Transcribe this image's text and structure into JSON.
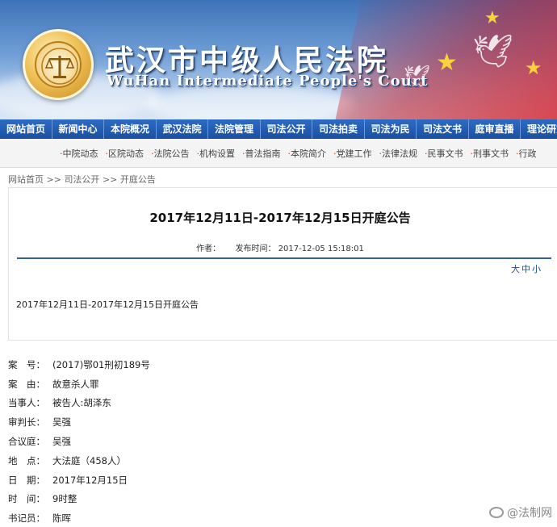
{
  "header": {
    "court_name_cn": "武汉市中级人民法院",
    "court_name_en": "WuHan Intermediate People's Court",
    "emblem_icon": "court-emblem-icon"
  },
  "main_nav": [
    "网站首页",
    "新闻中心",
    "本院概况",
    "武汉法院",
    "法院管理",
    "司法公开",
    "司法拍卖",
    "司法为民",
    "司法文书",
    "庭审直播",
    "理论研究"
  ],
  "sub_nav": [
    "中院动态",
    "区院动态",
    "法院公告",
    "机构设置",
    "普法指南",
    "本院简介",
    "党建工作",
    "法律法规",
    "民事文书",
    "刑事文书",
    "行政"
  ],
  "breadcrumb": {
    "home": "网站首页",
    "sep": ">>",
    "section": "司法公开",
    "current": "开庭公告"
  },
  "article": {
    "title": "2017年12月11日-2017年12月15日开庭公告",
    "author_label": "作者：",
    "publish_label": "发布时间：",
    "publish_time": "2017-12-05 15:18:01",
    "font_size_options": [
      "大",
      "中",
      "小"
    ],
    "lead": "2017年12月11日-2017年12月15日开庭公告"
  },
  "case_details": [
    {
      "label": "案　号：",
      "value": "(2017)鄂01刑初189号"
    },
    {
      "label": "案　由：",
      "value": "故意杀人罪"
    },
    {
      "label": "当事人：",
      "value": "被告人:胡泽东"
    },
    {
      "label": "审判长：",
      "value": "吴强"
    },
    {
      "label": "合议庭：",
      "value": "吴强"
    },
    {
      "label": "地　点：",
      "value": "大法庭（458人）"
    },
    {
      "label": "日　期：",
      "value": "2017年12月15日"
    },
    {
      "label": "时　间：",
      "value": "9时整"
    },
    {
      "label": "书记员：",
      "value": "陈晖"
    }
  ],
  "watermark": "@法制网",
  "colors": {
    "nav_blue": "#1a4fa0",
    "rule_blue": "#2f5f9e",
    "bullet_red": "#c0392b"
  }
}
